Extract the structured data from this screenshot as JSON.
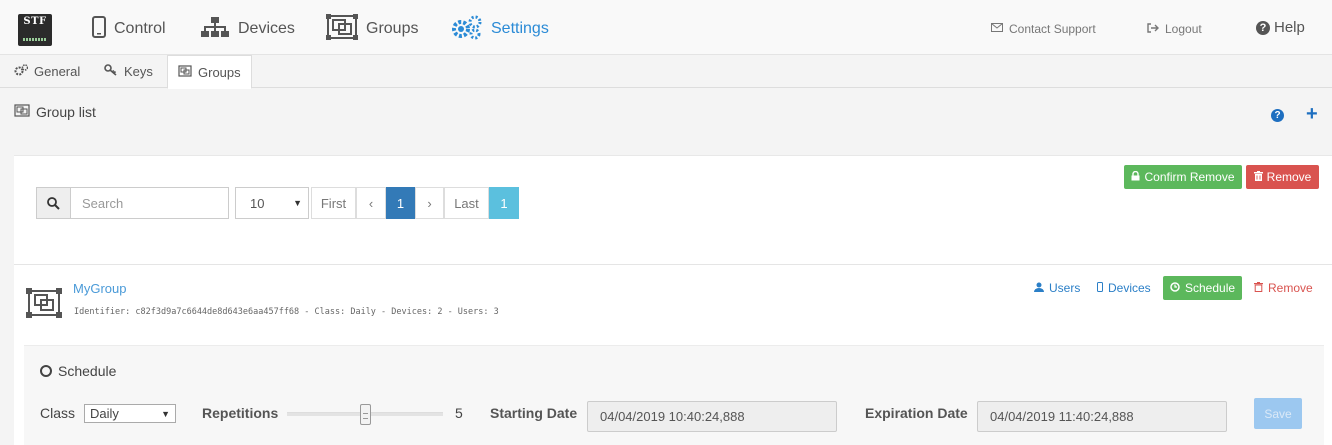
{
  "app": {
    "logo_text": "STF"
  },
  "nav": {
    "items": [
      {
        "label": "Control",
        "icon": "mobile-phone-icon"
      },
      {
        "label": "Devices",
        "icon": "sitemap-icon"
      },
      {
        "label": "Groups",
        "icon": "object-group-icon"
      },
      {
        "label": "Settings",
        "icon": "gears-icon",
        "active": true
      }
    ],
    "contact_support": "Contact Support",
    "logout": "Logout",
    "help": "Help"
  },
  "tabs": [
    {
      "label": "General",
      "icon": "gears-icon"
    },
    {
      "label": "Keys",
      "icon": "key-icon"
    },
    {
      "label": "Groups",
      "icon": "object-group-icon",
      "active": true
    }
  ],
  "group_list": {
    "title": "Group list",
    "confirm_remove_label": "Confirm Remove",
    "remove_label": "Remove",
    "search": {
      "placeholder": "Search",
      "value": ""
    },
    "per_page": "10",
    "pagination": {
      "first": "First",
      "prev": "‹",
      "current": "1",
      "next": "›",
      "last": "Last",
      "total_pages": "1"
    }
  },
  "group": {
    "name": "MyGroup",
    "meta": "Identifier: c82f3d9a7c6644de8d643e6aa457ff68 - Class: Daily - Devices: 2 - Users: 3",
    "actions": {
      "users": "Users",
      "devices": "Devices",
      "schedule": "Schedule",
      "remove": "Remove"
    }
  },
  "schedule": {
    "title": "Schedule",
    "class_label": "Class",
    "class_value": "Daily",
    "repetitions_label": "Repetitions",
    "repetitions_value": "5",
    "starting_date_label": "Starting Date",
    "starting_date_value": "04/04/2019 10:40:24,888",
    "expiration_date_label": "Expiration Date",
    "expiration_date_value": "04/04/2019 11:40:24,888",
    "save_label": "Save"
  },
  "colors": {
    "accent": "#2b8bd6",
    "success": "#5cb85c",
    "danger": "#d9534f",
    "primary": "#337ab7",
    "info": "#5bc0de"
  }
}
